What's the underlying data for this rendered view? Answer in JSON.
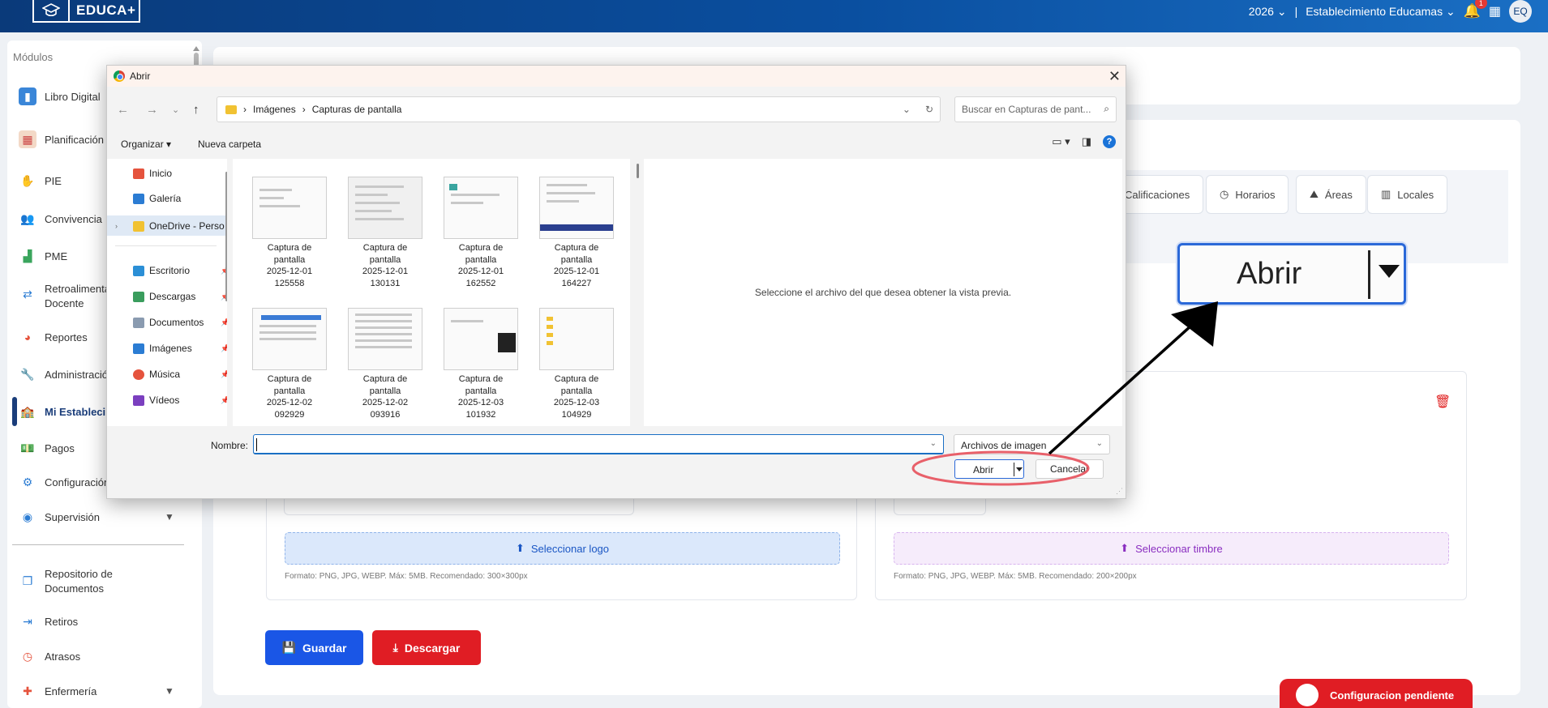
{
  "app": {
    "brand": "EDUCA+",
    "year": "2026",
    "separator": "|",
    "establishment": "Establecimiento Educamas",
    "notifications_count": "1",
    "user_initials": "EQ"
  },
  "sidebar": {
    "title": "Módulos",
    "items": [
      {
        "label": "Libro Digital",
        "icon": "book-icon"
      },
      {
        "label": "Planificación",
        "icon": "calendar-icon"
      },
      {
        "label": "PIE",
        "icon": "hand-icon"
      },
      {
        "label": "Convivencia",
        "icon": "people-icon"
      },
      {
        "label": "PME",
        "icon": "chart-icon"
      },
      {
        "label": "Retroalimentación",
        "label2": "Docente",
        "icon": "feedback-icon"
      },
      {
        "label": "Reportes",
        "icon": "pie-icon"
      },
      {
        "label": "Administración",
        "icon": "wrench-icon"
      },
      {
        "label": "Mi Establecimiento",
        "icon": "school-icon"
      },
      {
        "label": "Pagos",
        "icon": "money-icon"
      },
      {
        "label": "Configuración",
        "icon": "tools-icon"
      },
      {
        "label": "Supervisión",
        "icon": "supervision-icon"
      },
      {
        "label": "Repositorio de",
        "label2": "Documentos",
        "icon": "repository-icon"
      },
      {
        "label": "Retiros",
        "icon": "exit-icon"
      },
      {
        "label": "Atrasos",
        "icon": "clock-icon"
      },
      {
        "label": "Enfermería",
        "icon": "nurse-icon"
      }
    ]
  },
  "tabs": [
    "Calificaciones",
    "Horarios",
    "Áreas",
    "Locales"
  ],
  "zoom_callout": {
    "label": "Abrir"
  },
  "uploads": {
    "logo_button": "Seleccionar logo",
    "logo_note": "Formato: PNG, JPG, WEBP. Máx: 5MB. Recomendado: 300×300px",
    "timbre_button": "Seleccionar timbre",
    "timbre_note": "Formato: PNG, JPG, WEBP. Máx: 5MB. Recomendado: 200×200px"
  },
  "actions": {
    "save": "Guardar",
    "download": "Descargar"
  },
  "pending_banner": "Configuracion pendiente",
  "dialog": {
    "title": "Abrir",
    "breadcrumb": [
      "Imágenes",
      "Capturas de pantalla"
    ],
    "search_placeholder": "Buscar en Capturas de pant...",
    "organize": "Organizar",
    "new_folder": "Nueva carpeta",
    "nav_items": [
      {
        "label": "Inicio",
        "icon": "home-icon",
        "color": "#e5533d"
      },
      {
        "label": "Galería",
        "icon": "gallery-icon",
        "color": "#2b7cd3"
      },
      {
        "label": "OneDrive - Perso",
        "icon": "folder-icon",
        "color": "#f1c232"
      },
      {
        "label": "Escritorio",
        "icon": "desktop-icon",
        "color": "#2b8fd6"
      },
      {
        "label": "Descargas",
        "icon": "download-icon",
        "color": "#3a9d5d"
      },
      {
        "label": "Documentos",
        "icon": "documents-icon",
        "color": "#8a9bb0"
      },
      {
        "label": "Imágenes",
        "icon": "pictures-icon",
        "color": "#2b7cd3"
      },
      {
        "label": "Música",
        "icon": "music-icon",
        "color": "#e5533d"
      },
      {
        "label": "Vídeos",
        "icon": "videos-icon",
        "color": "#7b3fbf"
      }
    ],
    "files": [
      {
        "l1": "Captura de",
        "l2": "pantalla",
        "l3": "2025-12-01",
        "l4": "125558"
      },
      {
        "l1": "Captura de",
        "l2": "pantalla",
        "l3": "2025-12-01",
        "l4": "130131"
      },
      {
        "l1": "Captura de",
        "l2": "pantalla",
        "l3": "2025-12-01",
        "l4": "162552"
      },
      {
        "l1": "Captura de",
        "l2": "pantalla",
        "l3": "2025-12-01",
        "l4": "164227"
      },
      {
        "l1": "Captura de",
        "l2": "pantalla",
        "l3": "2025-12-02",
        "l4": "092929"
      },
      {
        "l1": "Captura de",
        "l2": "pantalla",
        "l3": "2025-12-02",
        "l4": "093916"
      },
      {
        "l1": "Captura de",
        "l2": "pantalla",
        "l3": "2025-12-03",
        "l4": "101932"
      },
      {
        "l1": "Captura de",
        "l2": "pantalla",
        "l3": "2025-12-03",
        "l4": "104929"
      }
    ],
    "preview_text": "Seleccione el archivo del que desea obtener la vista previa.",
    "name_label": "Nombre:",
    "name_value": "",
    "filter": "Archivos de imagen",
    "open_button": "Abrir",
    "cancel_button": "Cancelar"
  }
}
